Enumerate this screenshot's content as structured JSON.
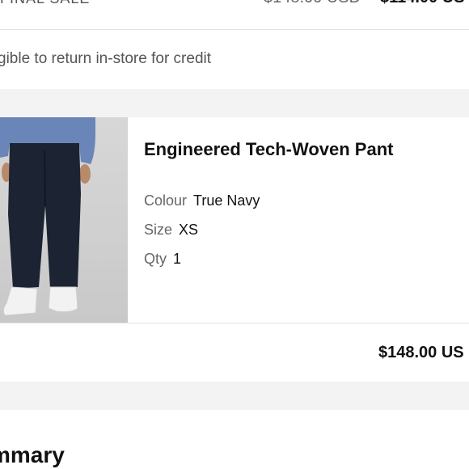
{
  "top_item": {
    "badge": "FINAL SALE",
    "original_price": "$148.00 USD",
    "sale_price": "$114.00 US"
  },
  "return_note": "gible to return in-store for credit",
  "product": {
    "name": "Engineered Tech-Woven Pant",
    "attributes": [
      {
        "label": "Colour",
        "value": "True Navy"
      },
      {
        "label": "Size",
        "value": "XS"
      },
      {
        "label": "Qty",
        "value": "1"
      }
    ],
    "line_price": "$148.00 US"
  },
  "summary_heading": "mmary",
  "colors": {
    "accent": "#111111",
    "background": "#f3f3f3"
  }
}
